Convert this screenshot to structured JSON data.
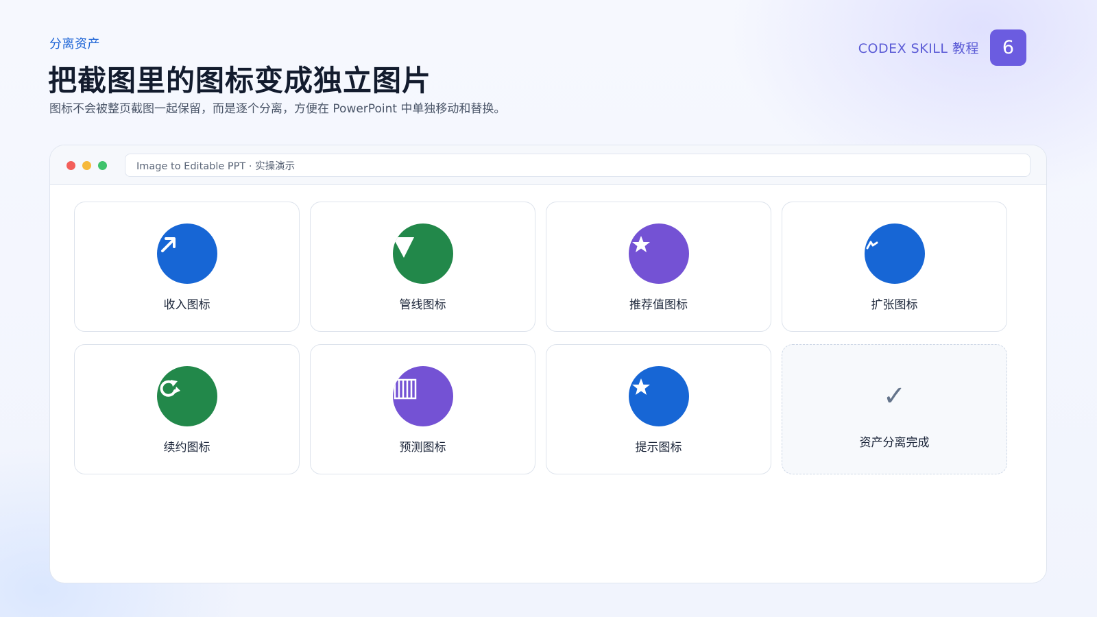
{
  "header": {
    "eyebrow": "分离资产",
    "title": "把截图里的图标变成独立图片",
    "subtitle": "图标不会被整页截图一起保留，而是逐个分离，方便在 PowerPoint 中单独移动和替换。",
    "brand": "CODEX SKILL 教程",
    "page_number": "6"
  },
  "window": {
    "address": "Image to Editable PPT  ·  实操演示"
  },
  "cards": [
    {
      "label": "收入图标",
      "icon": "arrow-up-right-icon",
      "color": "#1766d5"
    },
    {
      "label": "管线图标",
      "icon": "funnel-icon",
      "color": "#22884a"
    },
    {
      "label": "推荐值图标",
      "icon": "star-icon",
      "color": "#7452d4"
    },
    {
      "label": "扩张图标",
      "icon": "lightning-icon",
      "color": "#1766d5"
    },
    {
      "label": "续约图标",
      "icon": "refresh-icon",
      "color": "#22884a"
    },
    {
      "label": "预测图标",
      "icon": "bar-columns-icon",
      "color": "#7452d4"
    },
    {
      "label": "提示图标",
      "icon": "star-icon",
      "color": "#1766d5"
    },
    {
      "label": "资产分离完成",
      "icon": "checkmark-icon"
    }
  ],
  "done_mark": "✓"
}
